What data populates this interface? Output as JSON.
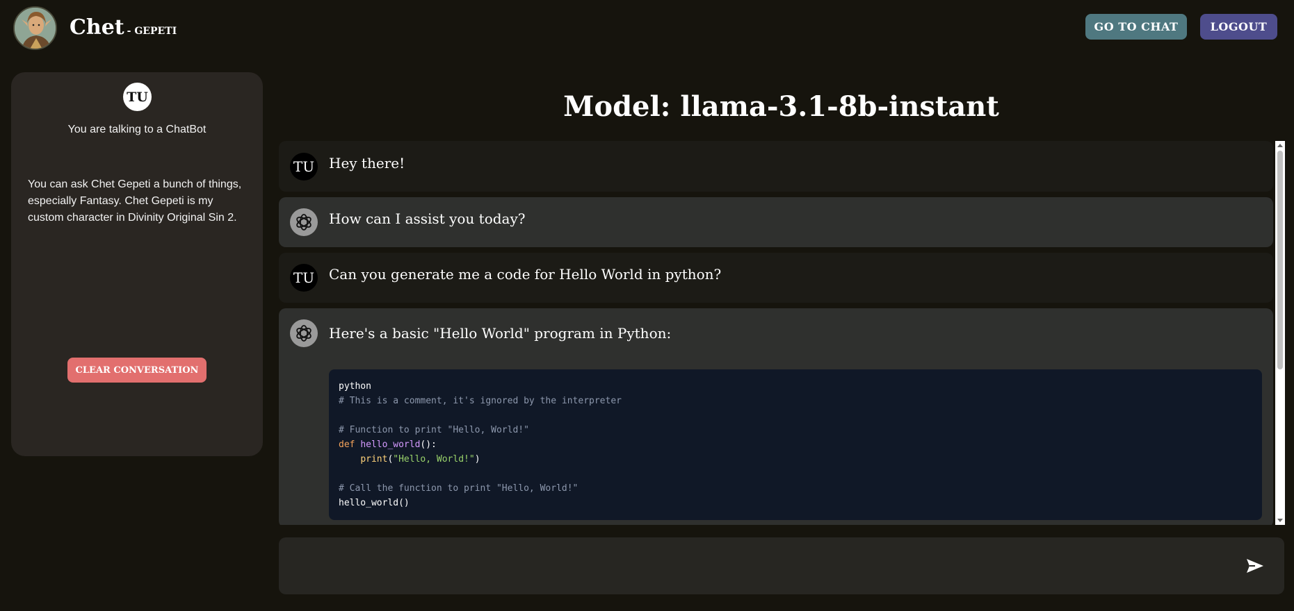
{
  "header": {
    "brand_name": "Chet",
    "brand_sub": "- GEPETI",
    "go_to_chat_label": "GO TO CHAT",
    "logout_label": "LOGOUT"
  },
  "sidebar": {
    "badge": "TU",
    "talking_to": "You are talking to a ChatBot",
    "description": "You can ask Chet Gepeti a bunch of things, especially Fantasy. Chet Gepeti is my custom character in Divinity Original Sin 2.",
    "clear_label": "CLEAR CONVERSATION"
  },
  "main": {
    "model_title": "Model: llama-3.1-8b-instant",
    "messages": [
      {
        "role": "user",
        "avatar": "TU",
        "text": "Hey there!"
      },
      {
        "role": "bot",
        "avatar": "openai-icon",
        "text": "How can I assist you today?"
      },
      {
        "role": "user",
        "avatar": "TU",
        "text": "Can you generate me a code for Hello World in python?"
      },
      {
        "role": "bot",
        "avatar": "openai-icon",
        "text": "Here's a basic \"Hello World\" program in Python:"
      }
    ],
    "code": {
      "lang": "python",
      "line1": "# This is a comment, it's ignored by the interpreter",
      "line3": "# Function to print \"Hello, World!\"",
      "kw_def": "def",
      "fn_name": "hello_world",
      "fn_sig_tail": "():",
      "indent": "    ",
      "print_call": "print",
      "print_open": "(",
      "print_str": "\"Hello, World!\"",
      "print_close": ")",
      "line7": "# Call the function to print \"Hello, World!\"",
      "line8": "hello_world()"
    },
    "input": {
      "value": "",
      "placeholder": ""
    }
  },
  "colors": {
    "background": "#16140d",
    "go_to_chat_button": "#4f7880",
    "logout_button": "#4e4d8c",
    "clear_button": "#e26f6e",
    "code_background": "#101827"
  }
}
